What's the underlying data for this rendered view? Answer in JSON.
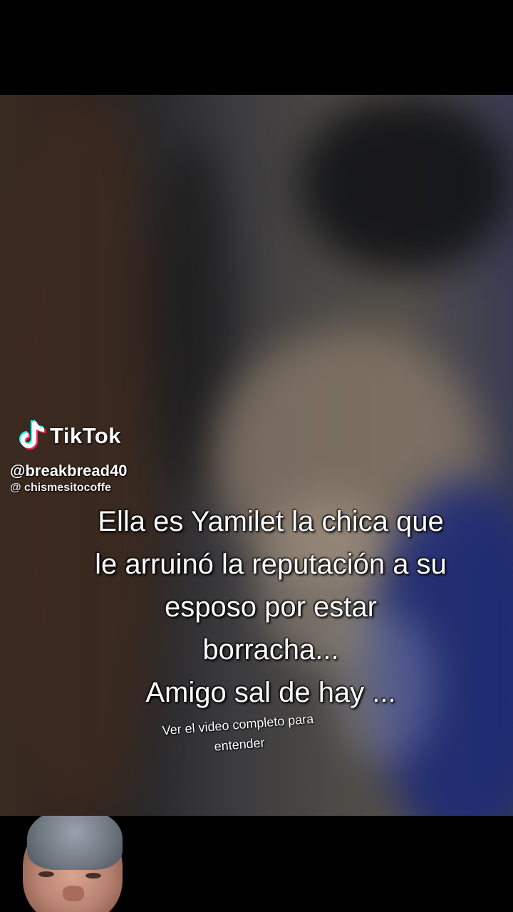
{
  "overlay": {
    "logo_text": "TikTok",
    "handle": "@breakbread40",
    "sub_handle": "@ chismesitocoffe"
  },
  "caption": {
    "lines": [
      "Ella es Yamilet la chica que",
      "le arruinó la reputación a su",
      "esposo por estar",
      "borracha...",
      "Amigo sal de hay ..."
    ]
  },
  "sub_caption": {
    "lines": [
      "Ver el video completo para",
      "entender"
    ]
  },
  "colors": {
    "background": "#000000",
    "tiktok_cyan": "#25F4EE",
    "tiktok_pink": "#FE2C55"
  }
}
